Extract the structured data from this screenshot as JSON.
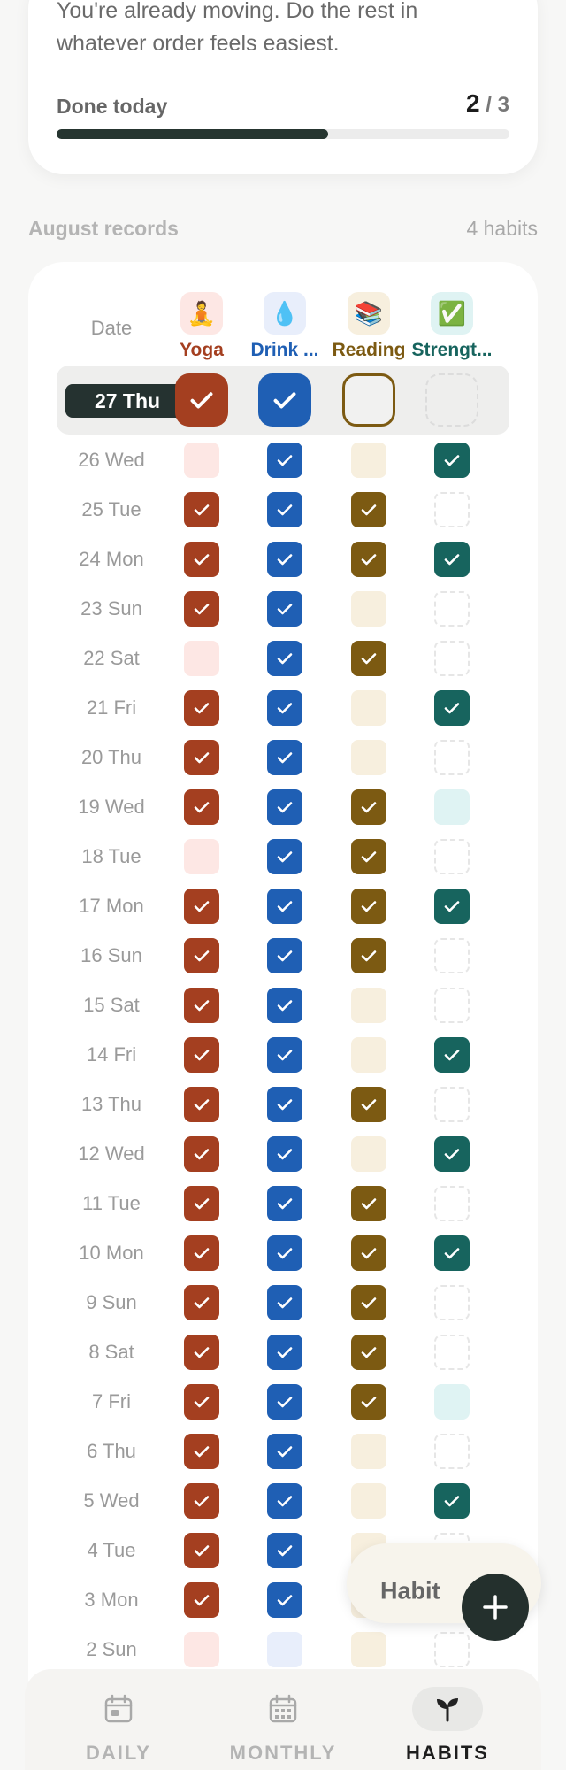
{
  "summary": {
    "message": "You're already moving. Do the rest in whatever order feels easiest.",
    "done_label": "Done today",
    "done_count": "2",
    "done_total": "3",
    "progress": 0.6
  },
  "section": {
    "title": "August records",
    "count": "4 habits"
  },
  "grid": {
    "date_header": "Date",
    "habits": [
      {
        "name": "Yoga",
        "emoji": "🧘",
        "color": "#a43f20",
        "soft": "#fde7e4",
        "label_color": "#a43f20"
      },
      {
        "name": "Drink ...",
        "emoji": "💧",
        "color": "#1f5fb4",
        "soft": "#e8eefb",
        "label_color": "#1f5fb4"
      },
      {
        "name": "Reading",
        "emoji": "📚",
        "color": "#7c5a12",
        "soft": "#f7efde",
        "label_color": "#7c5a12"
      },
      {
        "name": "Strengt...",
        "emoji": "✅",
        "color": "#17645e",
        "soft": "#dff3f3",
        "label_color": "#17645e"
      }
    ],
    "today": {
      "label": "27 Thu",
      "states": [
        "done",
        "done",
        "outlined",
        "dashed"
      ]
    },
    "rows": [
      {
        "label": "26 Wed",
        "states": [
          "soft",
          "done",
          "soft",
          "done"
        ]
      },
      {
        "label": "25 Tue",
        "states": [
          "done",
          "done",
          "done",
          "dashed"
        ]
      },
      {
        "label": "24 Mon",
        "states": [
          "done",
          "done",
          "done",
          "done"
        ]
      },
      {
        "label": "23 Sun",
        "states": [
          "done",
          "done",
          "soft",
          "dashed"
        ]
      },
      {
        "label": "22 Sat",
        "states": [
          "soft",
          "done",
          "done",
          "dashed"
        ]
      },
      {
        "label": "21 Fri",
        "states": [
          "done",
          "done",
          "soft",
          "done"
        ]
      },
      {
        "label": "20 Thu",
        "states": [
          "done",
          "done",
          "soft",
          "dashed"
        ]
      },
      {
        "label": "19 Wed",
        "states": [
          "done",
          "done",
          "done",
          "soft"
        ]
      },
      {
        "label": "18 Tue",
        "states": [
          "soft",
          "done",
          "done",
          "dashed"
        ]
      },
      {
        "label": "17 Mon",
        "states": [
          "done",
          "done",
          "done",
          "done"
        ]
      },
      {
        "label": "16 Sun",
        "states": [
          "done",
          "done",
          "done",
          "dashed"
        ]
      },
      {
        "label": "15 Sat",
        "states": [
          "done",
          "done",
          "soft",
          "dashed"
        ]
      },
      {
        "label": "14 Fri",
        "states": [
          "done",
          "done",
          "soft",
          "done"
        ]
      },
      {
        "label": "13 Thu",
        "states": [
          "done",
          "done",
          "done",
          "dashed"
        ]
      },
      {
        "label": "12 Wed",
        "states": [
          "done",
          "done",
          "soft",
          "done"
        ]
      },
      {
        "label": "11 Tue",
        "states": [
          "done",
          "done",
          "done",
          "dashed"
        ]
      },
      {
        "label": "10 Mon",
        "states": [
          "done",
          "done",
          "done",
          "done"
        ]
      },
      {
        "label": "9 Sun",
        "states": [
          "done",
          "done",
          "done",
          "dashed"
        ]
      },
      {
        "label": "8 Sat",
        "states": [
          "done",
          "done",
          "done",
          "dashed"
        ]
      },
      {
        "label": "7 Fri",
        "states": [
          "done",
          "done",
          "done",
          "soft"
        ]
      },
      {
        "label": "6 Thu",
        "states": [
          "done",
          "done",
          "soft",
          "dashed"
        ]
      },
      {
        "label": "5 Wed",
        "states": [
          "done",
          "done",
          "soft",
          "done"
        ]
      },
      {
        "label": "4 Tue",
        "states": [
          "done",
          "done",
          "soft",
          "dashed"
        ]
      },
      {
        "label": "3 Mon",
        "states": [
          "done",
          "done",
          "soft",
          "dashed"
        ]
      },
      {
        "label": "2 Sun",
        "states": [
          "soft",
          "soft",
          "soft",
          "dashed"
        ]
      }
    ]
  },
  "fab": {
    "label": "Habit",
    "icon": "plus-icon"
  },
  "nav": [
    {
      "label": "DAILY",
      "icon": "calendar-day-icon",
      "active": false
    },
    {
      "label": "MONTHLY",
      "icon": "calendar-month-icon",
      "active": false
    },
    {
      "label": "HABITS",
      "icon": "sprout-icon",
      "active": true
    }
  ]
}
